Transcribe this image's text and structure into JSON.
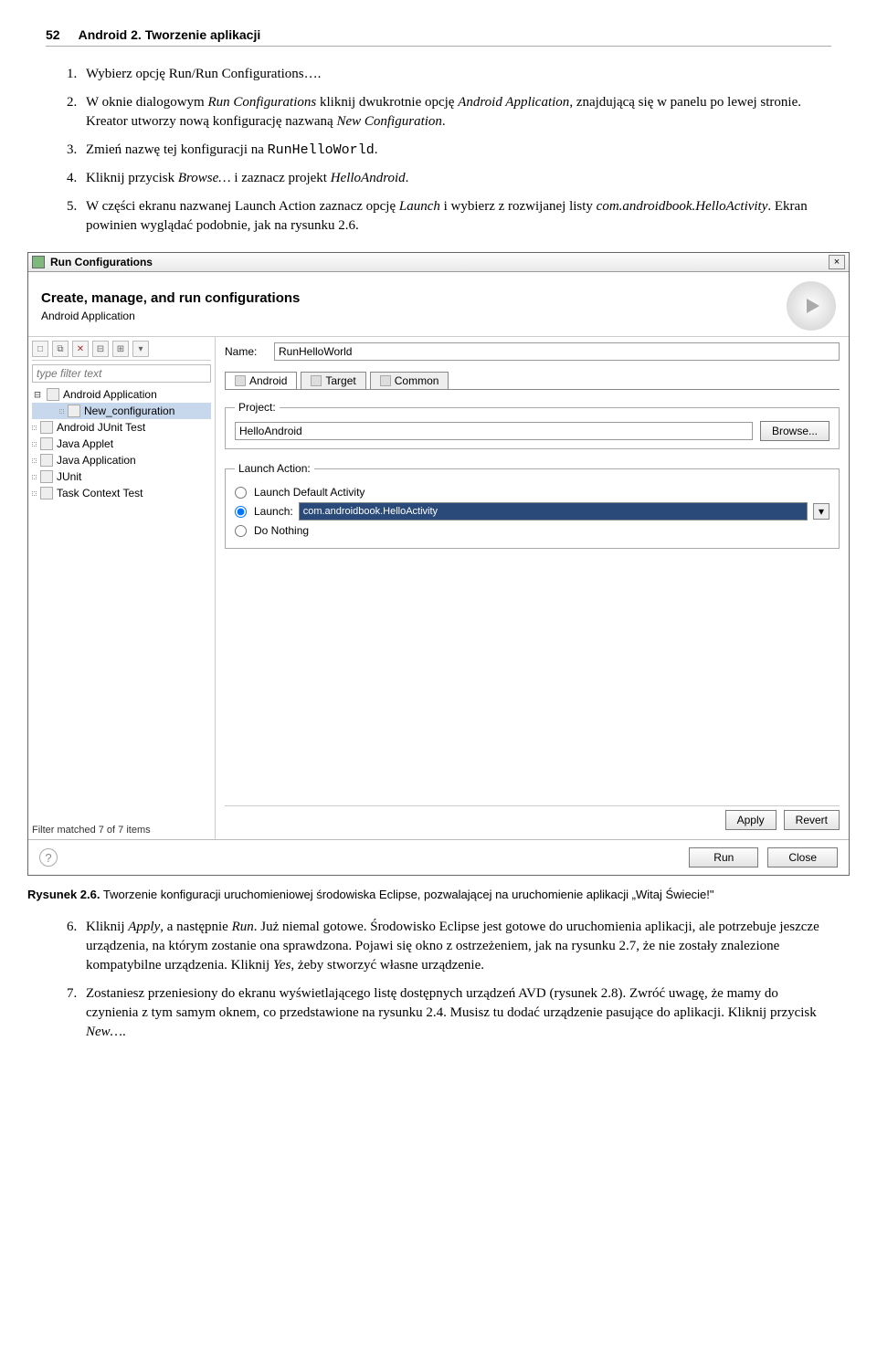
{
  "header": {
    "page_number": "52",
    "section": "Android 2. Tworzenie aplikacji"
  },
  "step1": "Wybierz opcję Run/Run Configurations….",
  "step2": {
    "a": "W oknie dialogowym ",
    "rc": "Run Configurations",
    "b": " kliknij dwukrotnie opcję ",
    "aa": "Android Application",
    "c": ", znajdującą się w panelu po lewej stronie. Kreator utworzy nową konfigurację nazwaną ",
    "nc": "New Configuration",
    "d": "."
  },
  "step3": {
    "a": "Zmień nazwę tej konfiguracji na ",
    "code": "RunHelloWorld",
    "b": "."
  },
  "step4": {
    "a": "Kliknij przycisk ",
    "browse": "Browse…",
    "b": " i zaznacz projekt ",
    "proj": "HelloAndroid",
    "c": "."
  },
  "step5": {
    "a": "W części ekranu nazwanej Launch Action zaznacz opcję ",
    "launch": "Launch",
    "b": " i wybierz z rozwijanej listy ",
    "cls": "com.androidbook.HelloActivity",
    "c": ". Ekran powinien wyglądać podobnie, jak na rysunku 2.6."
  },
  "dialog": {
    "title": "Run Configurations",
    "head_title": "Create, manage, and run configurations",
    "head_sub": "Android Application",
    "filter_placeholder": "type filter text",
    "tree": {
      "android_app": "Android Application",
      "new_config": "New_configuration",
      "junit": "Android JUnit Test",
      "applet": "Java Applet",
      "japp": "Java Application",
      "junit2": "JUnit",
      "task": "Task Context Test"
    },
    "tree_footer": "Filter matched 7 of 7 items",
    "name_label": "Name:",
    "name_value": "RunHelloWorld",
    "tabs": {
      "android": "Android",
      "target": "Target",
      "common": "Common"
    },
    "project_label": "Project:",
    "project_value": "HelloAndroid",
    "browse_btn": "Browse...",
    "launch_legend": "Launch Action:",
    "opt_default": "Launch Default Activity",
    "opt_launch": "Launch:",
    "opt_nothing": "Do Nothing",
    "launch_value": "com.androidbook.HelloActivity",
    "apply": "Apply",
    "revert": "Revert",
    "run": "Run",
    "close": "Close",
    "help": "?"
  },
  "caption": {
    "label": "Rysunek 2.6.",
    "text": " Tworzenie konfiguracji uruchomieniowej środowiska Eclipse, pozwalającej na uruchomienie aplikacji „Witaj Świecie!\""
  },
  "step6": {
    "a": "Kliknij ",
    "apply": "Apply",
    "b": ", a następnie ",
    "run": "Run",
    "c": ". Już niemal gotowe. Środowisko Eclipse jest gotowe do uruchomienia aplikacji, ale potrzebuje jeszcze urządzenia, na którym zostanie ona sprawdzona. Pojawi się okno z ostrzeżeniem, jak na rysunku 2.7, że nie zostały znalezione kompatybilne urządzenia. Kliknij ",
    "yes": "Yes",
    "d": ", żeby stworzyć własne urządzenie."
  },
  "step7": {
    "a": "Zostaniesz przeniesiony do ekranu wyświetlającego listę dostępnych urządzeń AVD (rysunek 2.8). Zwróć uwagę, że mamy do czynienia z tym samym oknem, co przedstawione na rysunku 2.4. Musisz tu dodać urządzenie pasujące do aplikacji. Kliknij przycisk ",
    "new": "New…",
    "b": "."
  }
}
